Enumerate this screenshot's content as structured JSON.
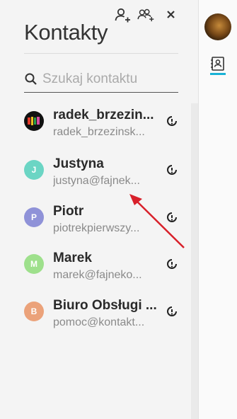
{
  "header": {
    "title": "Kontakty",
    "add_contact_icon": "add-person-icon",
    "add_group_icon": "add-group-icon",
    "close_icon": "close-icon"
  },
  "search": {
    "placeholder": "Szukaj kontaktu",
    "value": ""
  },
  "contacts": [
    {
      "name": "radek_brzezin...",
      "email": "radek_brzezinsk...",
      "avatar_letter": "",
      "avatar_color": "#1a1a1a",
      "status_icon": "status-info-icon"
    },
    {
      "name": "Justyna",
      "email": "justyna@fajnek...",
      "avatar_letter": "J",
      "avatar_color": "#6bd5c4",
      "status_icon": "status-info-icon"
    },
    {
      "name": "Piotr",
      "email": "piotrekpierwszy...",
      "avatar_letter": "P",
      "avatar_color": "#8f92d8",
      "status_icon": "status-info-icon"
    },
    {
      "name": "Marek",
      "email": "marek@fajneko...",
      "avatar_letter": "M",
      "avatar_color": "#9ee08c",
      "status_icon": "status-info-icon"
    },
    {
      "name": "Biuro Obsługi ...",
      "email": "pomoc@kontakt...",
      "avatar_letter": "B",
      "avatar_color": "#eba27a",
      "status_icon": "status-info-icon"
    }
  ],
  "sidebar": {
    "contacts_tab_icon": "contacts-card-icon",
    "accent_color": "#19b2d6"
  },
  "annotation": {
    "arrow_color": "#d8202a"
  }
}
